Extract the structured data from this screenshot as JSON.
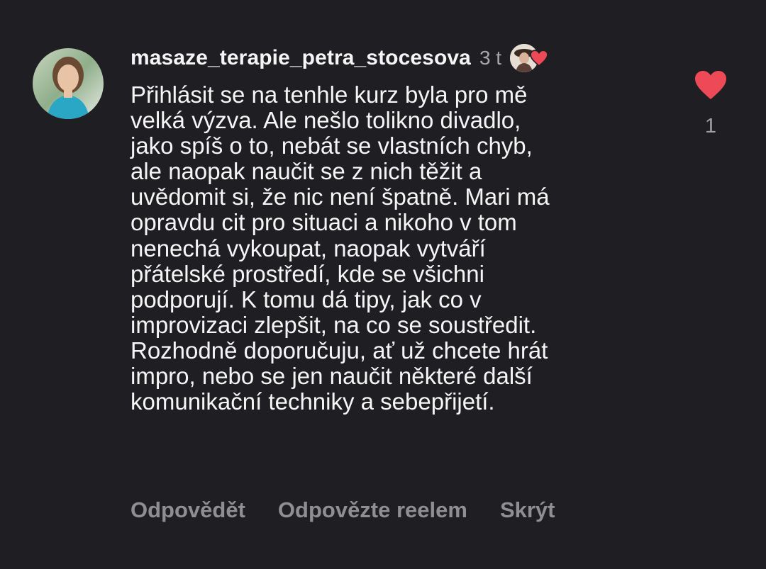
{
  "comment": {
    "username": "masaze_terapie_petra_stocesova",
    "timestamp": "3 t",
    "avatar_icon": "user-avatar-photo",
    "creator_liked_icon": "creator-avatar-with-heart",
    "lines": [
      "Přihlásit se na tenhle kurz byla pro mě",
      "velká výzva. Ale nešlo tolikno divadlo,",
      "jako spíš o to, nebát se vlastních chyb,",
      "ale naopak naučit se z nich těžit a",
      "uvědomit si, že nic není špatně. Mari má",
      "opravdu cit pro situaci a nikoho v tom",
      "nenechá vykoupat, naopak vytváří",
      "přátelské prostředí, kde se všichni",
      "podporují. K tomu dá tipy, jak co v",
      "improvizaci zlepšit, na co se soustředit.",
      "Rozhodně doporučuju, ať už chcete hrát",
      "impro, nebo se jen naučit některé další",
      "komunikační techniky a sebepřijetí."
    ]
  },
  "actions": {
    "reply_label": "Odpovědět",
    "reply_reel_label": "Odpovězte reelem",
    "hide_label": "Skrýt"
  },
  "like": {
    "icon": "heart-filled-icon",
    "count": "1",
    "liked": true
  },
  "colors": {
    "background": "#1f1f23",
    "text": "#f5f5f5",
    "muted": "#8e8e93",
    "heart": "#ed4956"
  }
}
